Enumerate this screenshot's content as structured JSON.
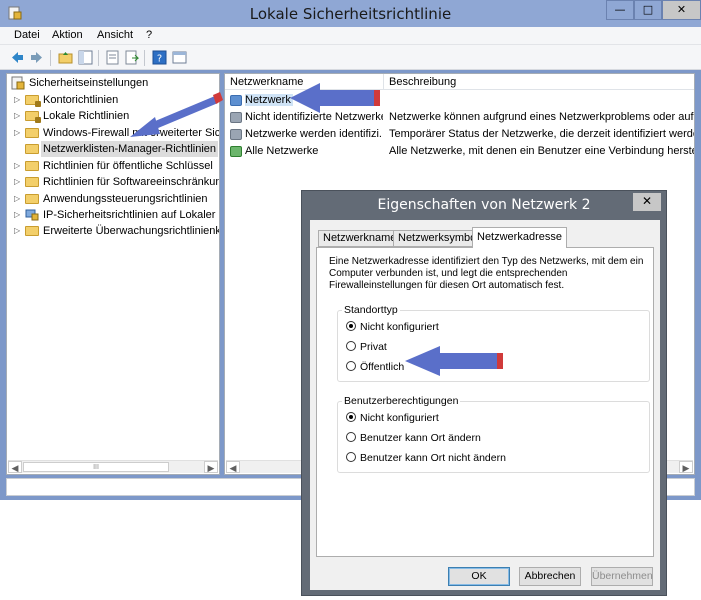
{
  "window": {
    "title": "Lokale Sicherheitsrichtlinie",
    "minimize_glyph": "—",
    "maximize_glyph": "□",
    "close_glyph": "✕"
  },
  "menu": [
    "Datei",
    "Aktion",
    "Ansicht",
    "?"
  ],
  "toolbar": {
    "icons": [
      "back-icon",
      "forward-icon",
      "up-folder-icon",
      "show-hide-tree-icon",
      "properties-icon",
      "export-list-icon",
      "help-icon",
      "details-icon"
    ]
  },
  "tree": {
    "root": "Sicherheitseinstellungen",
    "items": [
      {
        "label": "Kontorichtlinien",
        "expander": "▷"
      },
      {
        "label": "Lokale Richtlinien",
        "expander": "▷"
      },
      {
        "label": "Windows-Firewall mit erweiterter Sich",
        "expander": "▷"
      },
      {
        "label": "Netzwerklisten-Manager-Richtlinien",
        "expander": ""
      },
      {
        "label": "Richtlinien für öffentliche Schlüssel",
        "expander": "▷"
      },
      {
        "label": "Richtlinien für Softwareeinschränkung",
        "expander": "▷"
      },
      {
        "label": "Anwendungssteuerungsrichtlinien",
        "expander": "▷"
      },
      {
        "label": "IP-Sicherheitsrichtlinien auf Lokaler C",
        "expander": "▷"
      },
      {
        "label": "Erweiterte Überwachungsrichtlinienko",
        "expander": "▷"
      }
    ],
    "scroll_left": "◀",
    "scroll_right": "▶",
    "scroll_thumb": "III"
  },
  "list": {
    "columns": [
      "Netzwerkname",
      "Beschreibung"
    ],
    "rows": [
      {
        "name": "Netzwerk",
        "desc": ""
      },
      {
        "name": "Nicht identifizierte Netzwerke",
        "desc": "Netzwerke können aufgrund eines Netzwerkproblems oder aufgru"
      },
      {
        "name": "Netzwerke werden identifizi...",
        "desc": "Temporärer Status der Netzwerke, die derzeit identifiziert werden."
      },
      {
        "name": "Alle Netzwerke",
        "desc": "Alle Netzwerke, mit denen ein Benutzer eine Verbindung herstellt."
      }
    ],
    "scroll_left": "◀",
    "scroll_right": "▶"
  },
  "dialog": {
    "title": "Eigenschaften von Netzwerk  2",
    "close_glyph": "✕",
    "tabs": [
      "Netzwerkname",
      "Netzwerksymbol",
      "Netzwerkadresse"
    ],
    "description": "Eine Netzwerkadresse identifiziert den Typ des Netzwerks, mit dem ein Computer verbunden ist, und legt die entsprechenden Firewalleinstellungen für diesen Ort automatisch fest.",
    "location_group": {
      "title": "Standorttyp",
      "options": [
        "Nicht konfiguriert",
        "Privat",
        "Öffentlich"
      ],
      "selected": "Nicht konfiguriert"
    },
    "permissions_group": {
      "title": "Benutzerberechtigungen",
      "options": [
        "Nicht konfiguriert",
        "Benutzer kann Ort ändern",
        "Benutzer kann Ort nicht ändern"
      ],
      "selected": "Nicht konfiguriert"
    },
    "buttons": {
      "ok": "OK",
      "cancel": "Abbrechen",
      "apply": "Übernehmen"
    }
  },
  "colors": {
    "arrow": "#5a6fc9",
    "arrow_tail": "#d03a3a",
    "dialog_frame": "#636b76",
    "window_title": "#8fa7d4"
  }
}
